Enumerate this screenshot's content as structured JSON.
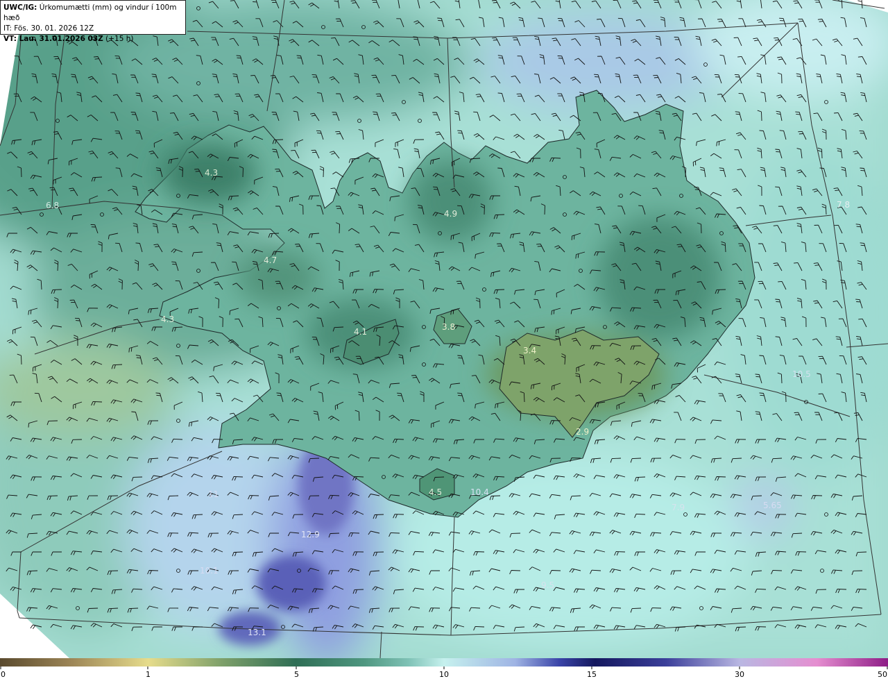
{
  "header": {
    "line1_bold": "UWC/IG:",
    "line1_rest": " Úrkomumætti (mm) og vindur í 100m hæð",
    "line2": "IT: Fös. 30. 01. 2026 12Z",
    "line3_bold": "VT: Lau. 31.01.2026 03Z",
    "line3_rest": " (+15 h)"
  },
  "map_values": [
    "4.3",
    "6.8",
    "4.9",
    "7.8",
    "4.7",
    "4.3",
    "4.1",
    "3.8",
    "3.4",
    "10.5",
    "2.9",
    "4.5",
    "10.4",
    "11",
    "7.9",
    "5.65",
    "12.9",
    "10.1",
    "9.5",
    "13.1"
  ],
  "colorbar": {
    "ticks": [
      "0",
      "1",
      "5",
      "10",
      "15",
      "30",
      "50"
    ],
    "colors": {
      "dry": "#5a4a2e",
      "tan": "#c9b57a",
      "yellow": "#e6dc8c",
      "green_dark": "#2f6e55",
      "green": "#4f9780",
      "teal": "#7fc2b6",
      "cyan_light": "#c6f1ee",
      "blue_light": "#9fb4e4",
      "blue": "#3a44a8",
      "navy": "#14185e",
      "lavender": "#b9b7e2",
      "pink": "#e58ed0",
      "magenta": "#8e1d86"
    }
  },
  "icons": {
    "wind": "wind-barb-icon",
    "calm": "calm-circle-icon"
  }
}
